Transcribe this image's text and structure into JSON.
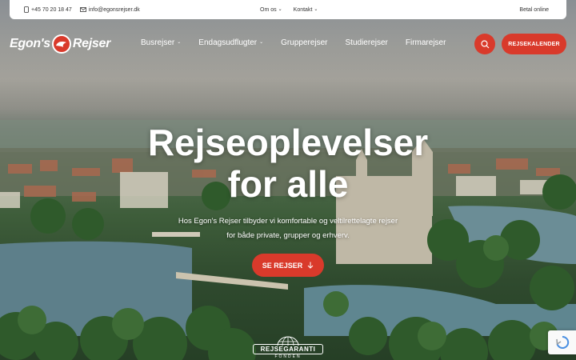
{
  "topbar": {
    "phone": "+45 70 20 18 47",
    "email": "info@egonsrejser.dk",
    "menu": [
      "Om os",
      "Kontakt"
    ],
    "pay": "Betal online"
  },
  "logo": {
    "left": "Egon's",
    "right": "Rejser"
  },
  "nav": {
    "items": [
      {
        "label": "Busrejser",
        "dropdown": true
      },
      {
        "label": "Endagsudflugter",
        "dropdown": true
      },
      {
        "label": "Grupperejser",
        "dropdown": false
      },
      {
        "label": "Studierejser",
        "dropdown": false
      },
      {
        "label": "Firmarejser",
        "dropdown": false
      }
    ],
    "calendar_label": "REJSEKALENDER"
  },
  "hero": {
    "title_line1": "Rejseoplevelser",
    "title_line2": "for alle",
    "subtitle_line1": "Hos Egon's Rejser tilbyder vi komfortable og veltilrettelagte rejser",
    "subtitle_line2": "for både private, grupper og erhverv.",
    "cta_label": "SE REJSER"
  },
  "badge": {
    "name": "REJSEGARANTI",
    "sub": "FONDEN"
  },
  "colors": {
    "accent": "#d93a2b",
    "text_on_dark": "#ffffff"
  },
  "icons": [
    "phone-icon",
    "mail-icon",
    "search-icon",
    "arrow-down-icon",
    "recaptcha-icon"
  ]
}
